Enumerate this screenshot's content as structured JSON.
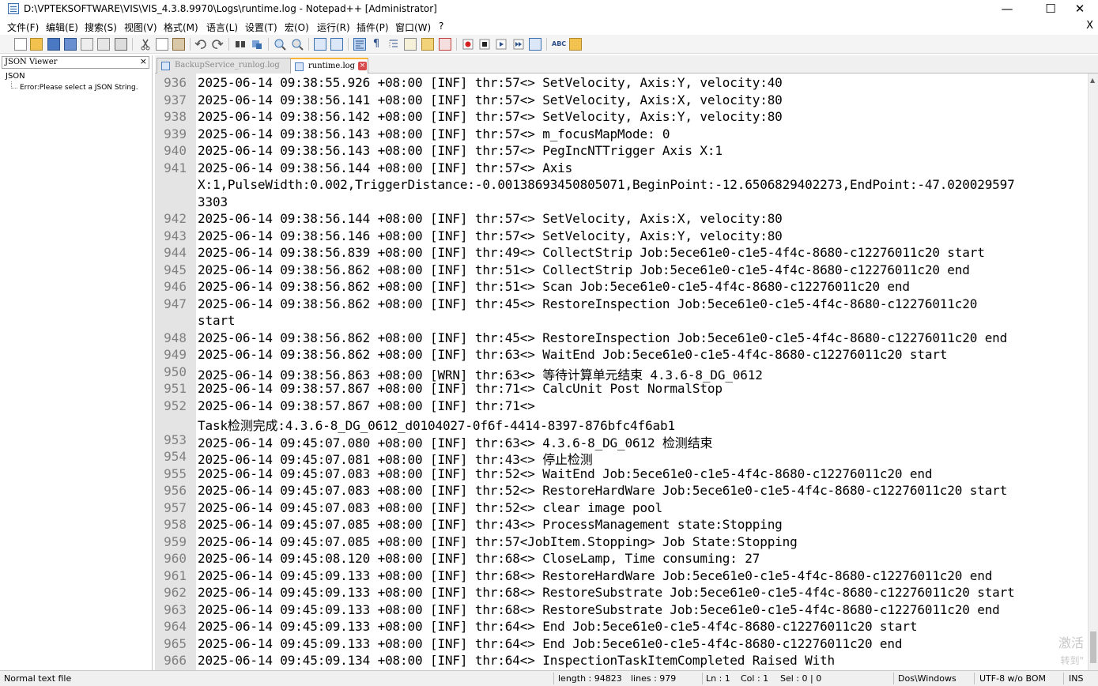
{
  "window": {
    "title": "D:\\VPTEKSOFTWARE\\VIS\\VIS_4.3.8.9970\\Logs\\runtime.log - Notepad++ [Administrator]",
    "minimize": "—",
    "maximize": "☐",
    "close": "✕"
  },
  "menu": {
    "items": [
      "文件(F)",
      "编辑(E)",
      "搜索(S)",
      "视图(V)",
      "格式(M)",
      "语言(L)",
      "设置(T)",
      "宏(O)",
      "运行(R)",
      "插件(P)",
      "窗口(W)",
      "?"
    ],
    "close": "X"
  },
  "left_panel": {
    "title": "JSON Viewer",
    "close": "×",
    "tree_root": "JSON",
    "tree_child": "Error:Please select a JSON String."
  },
  "tabs": [
    {
      "label": "BackupService_runlog.log",
      "active": false
    },
    {
      "label": "runtime.log",
      "active": true
    }
  ],
  "editor": {
    "lines": [
      {
        "n": "936",
        "t": "2025-06-14 09:38:55.926 +08:00 [INF] thr:57<> SetVelocity, Axis:Y, velocity:40"
      },
      {
        "n": "937",
        "t": "2025-06-14 09:38:56.141 +08:00 [INF] thr:57<> SetVelocity, Axis:X, velocity:80"
      },
      {
        "n": "938",
        "t": "2025-06-14 09:38:56.142 +08:00 [INF] thr:57<> SetVelocity, Axis:Y, velocity:80"
      },
      {
        "n": "939",
        "t": "2025-06-14 09:38:56.143 +08:00 [INF] thr:57<> m_focusMapMode: 0"
      },
      {
        "n": "940",
        "t": "2025-06-14 09:38:56.143 +08:00 [INF] thr:57<> PegIncNTTrigger Axis X:1"
      },
      {
        "n": "941",
        "t": "2025-06-14 09:38:56.144 +08:00 [INF] thr:57<> Axis"
      },
      {
        "n": "",
        "t": "X:1,PulseWidth:0.002,TriggerDistance:-0.00138693450805071,BeginPoint:-12.6506829402273,EndPoint:-47.020029597"
      },
      {
        "n": "",
        "t": "3303"
      },
      {
        "n": "942",
        "t": "2025-06-14 09:38:56.144 +08:00 [INF] thr:57<> SetVelocity, Axis:X, velocity:80"
      },
      {
        "n": "943",
        "t": "2025-06-14 09:38:56.146 +08:00 [INF] thr:57<> SetVelocity, Axis:Y, velocity:80"
      },
      {
        "n": "944",
        "t": "2025-06-14 09:38:56.839 +08:00 [INF] thr:49<> CollectStrip Job:5ece61e0-c1e5-4f4c-8680-c12276011c20 start"
      },
      {
        "n": "945",
        "t": "2025-06-14 09:38:56.862 +08:00 [INF] thr:51<> CollectStrip Job:5ece61e0-c1e5-4f4c-8680-c12276011c20 end"
      },
      {
        "n": "946",
        "t": "2025-06-14 09:38:56.862 +08:00 [INF] thr:51<> Scan Job:5ece61e0-c1e5-4f4c-8680-c12276011c20 end"
      },
      {
        "n": "947",
        "t": "2025-06-14 09:38:56.862 +08:00 [INF] thr:45<> RestoreInspection Job:5ece61e0-c1e5-4f4c-8680-c12276011c20"
      },
      {
        "n": "",
        "t": "start"
      },
      {
        "n": "948",
        "t": "2025-06-14 09:38:56.862 +08:00 [INF] thr:45<> RestoreInspection Job:5ece61e0-c1e5-4f4c-8680-c12276011c20 end"
      },
      {
        "n": "949",
        "t": "2025-06-14 09:38:56.862 +08:00 [INF] thr:63<> WaitEnd Job:5ece61e0-c1e5-4f4c-8680-c12276011c20 start"
      },
      {
        "n": "950",
        "t": "2025-06-14 09:38:56.863 +08:00 [WRN] thr:63<> 等待计算单元结束 4.3.6-8_DG_0612"
      },
      {
        "n": "951",
        "t": "2025-06-14 09:38:57.867 +08:00 [INF] thr:71<> CalcUnit Post NormalStop"
      },
      {
        "n": "952",
        "t": "2025-06-14 09:38:57.867 +08:00 [INF] thr:71<>"
      },
      {
        "n": "",
        "t": "Task检测完成:4.3.6-8_DG_0612_d0104027-0f6f-4414-8397-876bfc4f6ab1"
      },
      {
        "n": "953",
        "t": "2025-06-14 09:45:07.080 +08:00 [INF] thr:63<> 4.3.6-8_DG_0612 检测结束"
      },
      {
        "n": "954",
        "t": "2025-06-14 09:45:07.081 +08:00 [INF] thr:43<> 停止检测"
      },
      {
        "n": "955",
        "t": "2025-06-14 09:45:07.083 +08:00 [INF] thr:52<> WaitEnd Job:5ece61e0-c1e5-4f4c-8680-c12276011c20 end"
      },
      {
        "n": "956",
        "t": "2025-06-14 09:45:07.083 +08:00 [INF] thr:52<> RestoreHardWare Job:5ece61e0-c1e5-4f4c-8680-c12276011c20 start"
      },
      {
        "n": "957",
        "t": "2025-06-14 09:45:07.083 +08:00 [INF] thr:52<> clear image pool"
      },
      {
        "n": "958",
        "t": "2025-06-14 09:45:07.085 +08:00 [INF] thr:43<> ProcessManagement state:Stopping"
      },
      {
        "n": "959",
        "t": "2025-06-14 09:45:07.085 +08:00 [INF] thr:57<JobItem.Stopping> Job State:Stopping"
      },
      {
        "n": "960",
        "t": "2025-06-14 09:45:08.120 +08:00 [INF] thr:68<> CloseLamp, Time consuming: 27"
      },
      {
        "n": "961",
        "t": "2025-06-14 09:45:09.133 +08:00 [INF] thr:68<> RestoreHardWare Job:5ece61e0-c1e5-4f4c-8680-c12276011c20 end"
      },
      {
        "n": "962",
        "t": "2025-06-14 09:45:09.133 +08:00 [INF] thr:68<> RestoreSubstrate Job:5ece61e0-c1e5-4f4c-8680-c12276011c20 start"
      },
      {
        "n": "963",
        "t": "2025-06-14 09:45:09.133 +08:00 [INF] thr:68<> RestoreSubstrate Job:5ece61e0-c1e5-4f4c-8680-c12276011c20 end"
      },
      {
        "n": "964",
        "t": "2025-06-14 09:45:09.133 +08:00 [INF] thr:64<> End Job:5ece61e0-c1e5-4f4c-8680-c12276011c20 start"
      },
      {
        "n": "965",
        "t": "2025-06-14 09:45:09.133 +08:00 [INF] thr:64<> End Job:5ece61e0-c1e5-4f4c-8680-c12276011c20 end"
      },
      {
        "n": "966",
        "t": "2025-06-14 09:45:09.134 +08:00 [INF] thr:64<> InspectionTaskItemCompleted Raised With"
      }
    ]
  },
  "watermark": {
    "line1": "激活",
    "line2": "转到\""
  },
  "status": {
    "file_type": "Normal text file",
    "length": "length : 94823",
    "lines": "lines : 979",
    "ln": "Ln : 1",
    "col": "Col : 1",
    "sel": "Sel : 0 | 0",
    "eol": "Dos\\Windows",
    "encoding": "UTF-8 w/o BOM",
    "mode": "INS"
  },
  "colors": {
    "tab_active_accent": "#fab437",
    "tab_close": "#d94b4b",
    "gutter": "#e4e4e4"
  }
}
